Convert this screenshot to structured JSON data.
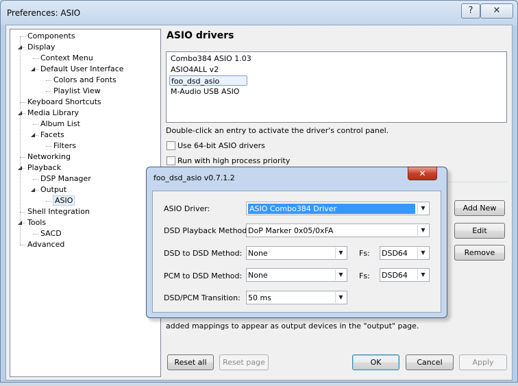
{
  "window": {
    "title": "Preferences: ASIO",
    "help": "?",
    "close": "✕"
  },
  "tree": [
    {
      "label": "Components",
      "depth": 0,
      "toggle": ""
    },
    {
      "label": "Display",
      "depth": 0,
      "toggle": "◢"
    },
    {
      "label": "Context Menu",
      "depth": 1,
      "toggle": ""
    },
    {
      "label": "Default User Interface",
      "depth": 1,
      "toggle": "◢"
    },
    {
      "label": "Colors and Fonts",
      "depth": 2,
      "toggle": ""
    },
    {
      "label": "Playlist View",
      "depth": 2,
      "toggle": ""
    },
    {
      "label": "Keyboard Shortcuts",
      "depth": 0,
      "toggle": ""
    },
    {
      "label": "Media Library",
      "depth": 0,
      "toggle": "◢"
    },
    {
      "label": "Album List",
      "depth": 1,
      "toggle": ""
    },
    {
      "label": "Facets",
      "depth": 1,
      "toggle": "◢"
    },
    {
      "label": "Filters",
      "depth": 2,
      "toggle": ""
    },
    {
      "label": "Networking",
      "depth": 0,
      "toggle": ""
    },
    {
      "label": "Playback",
      "depth": 0,
      "toggle": "◢"
    },
    {
      "label": "DSP Manager",
      "depth": 1,
      "toggle": ""
    },
    {
      "label": "Output",
      "depth": 1,
      "toggle": "◢"
    },
    {
      "label": "ASIO",
      "depth": 2,
      "toggle": "",
      "selected": true
    },
    {
      "label": "Shell Integration",
      "depth": 0,
      "toggle": ""
    },
    {
      "label": "Tools",
      "depth": 0,
      "toggle": "◢"
    },
    {
      "label": "SACD",
      "depth": 1,
      "toggle": ""
    },
    {
      "label": "Advanced",
      "depth": 0,
      "toggle": ""
    }
  ],
  "panel": {
    "title": "ASIO drivers",
    "drivers": [
      "Combo384 ASIO 1.03",
      "ASIO4ALL v2",
      "foo_dsd_asio",
      "M-Audio USB ASIO"
    ],
    "selected_driver": 2,
    "hint": "Double-click an entry to activate the driver's control panel.",
    "checkbox_64bit": "Use 64-bit ASIO drivers",
    "checkbox_priority": "Run with high process priority",
    "add_new": "Add New",
    "edit": "Edit",
    "remove": "Remove",
    "mappings_text": "added mappings to appear as output devices in the \"output\" page."
  },
  "footer": {
    "reset_all": "Reset all",
    "reset_page": "Reset page",
    "ok": "OK",
    "cancel": "Cancel",
    "apply": "Apply"
  },
  "dialog": {
    "title": "foo_dsd_asio v0.7.1.2",
    "close": "✕",
    "asio_driver_label": "ASIO Driver:",
    "asio_driver_value": "ASIO Combo384 Driver",
    "dsd_playback_label": "DSD Playback Method:",
    "dsd_playback_value": "DoP Marker 0x05/0xFA",
    "dsd_to_dsd_label": "DSD to DSD Method:",
    "dsd_to_dsd_value": "None",
    "pcm_to_dsd_label": "PCM to DSD Method:",
    "pcm_to_dsd_value": "None",
    "fs_label": "Fs:",
    "fs1_value": "DSD64",
    "fs2_value": "DSD64",
    "transition_label": "DSD/PCM Transition:",
    "transition_value": "50 ms"
  }
}
